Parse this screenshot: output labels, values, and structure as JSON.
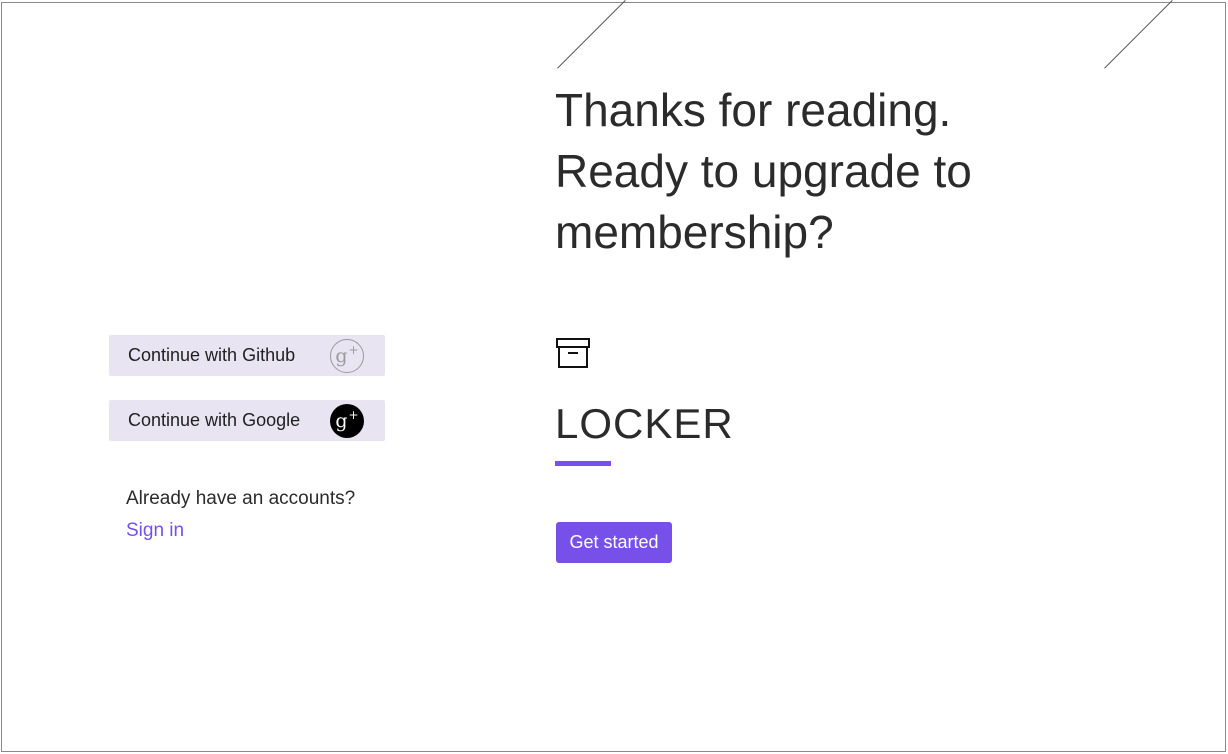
{
  "auth": {
    "github_label": "Continue with Github",
    "google_label": "Continue with Google",
    "github_icon": "google-plus-outline-icon",
    "google_icon": "google-plus-solid-icon",
    "icon_glyph": "g",
    "icon_sup": "+",
    "already_text": "Already have an accounts?",
    "signin_label": "Sign in"
  },
  "promo": {
    "headline": "Thanks for reading. Ready to upgrade to membership?",
    "brand_icon": "archive-box-icon",
    "brand_name": "LOCKER",
    "cta_label": "Get started"
  },
  "colors": {
    "accent": "#7650e8",
    "button_bg": "#e8e4f2",
    "text": "#2b2b2b"
  }
}
